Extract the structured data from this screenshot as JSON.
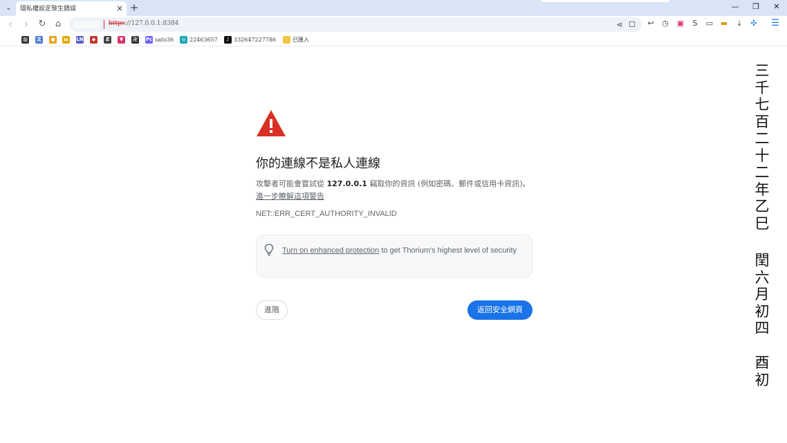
{
  "tab": {
    "title": "隱私權設定發生錯誤",
    "close_glyph": "×"
  },
  "tabstrip": {
    "new_tab_glyph": "+",
    "minimize_glyph": "—",
    "restore_glyph": "❐",
    "close_glyph": "✕"
  },
  "toolbar": {
    "back_glyph": "‹",
    "forward_glyph": "›",
    "reload_glyph": "↻",
    "home_glyph": "⌂",
    "url_scheme": "https",
    "url_rest": "://127.0.0.1:8384",
    "share_glyph": "⋖",
    "bookmark_glyph": "☐",
    "menu_glyph": "☰"
  },
  "extensions": [
    {
      "icon": "reply-arrow-icon",
      "glyph": "↩"
    },
    {
      "icon": "clock-icon",
      "glyph": "◷"
    },
    {
      "icon": "red-square-icon",
      "glyph": "▣"
    },
    {
      "icon": "s-letter-icon",
      "glyph": "S"
    },
    {
      "icon": "wallet-icon",
      "glyph": "▭"
    },
    {
      "icon": "folder-icon",
      "glyph": "▬"
    },
    {
      "icon": "download-icon",
      "glyph": "⤓"
    },
    {
      "icon": "puzzle-icon",
      "glyph": "✣"
    }
  ],
  "bookmarks": [
    {
      "label": "",
      "glyph": "▥",
      "color": "#333333"
    },
    {
      "label": "",
      "glyph": "文",
      "color": "#4a7bd0"
    },
    {
      "label": "",
      "glyph": "●",
      "color": "#e8a317"
    },
    {
      "label": "",
      "glyph": "ы",
      "color": "#e5a800"
    },
    {
      "label": "",
      "glyph": "LN",
      "color": "#5b5fc7"
    },
    {
      "label": "",
      "glyph": "◆",
      "color": "#c0392b"
    },
    {
      "label": "",
      "glyph": "Ƶ",
      "color": "#444444"
    },
    {
      "label": "",
      "glyph": "▼",
      "color": "#d6336c"
    },
    {
      "label": "",
      "glyph": "卍",
      "color": "#2f2f2f"
    },
    {
      "label": "sato36",
      "glyph": "Pc",
      "color": "#6c63ff"
    },
    {
      "label": "22463657",
      "glyph": "◎",
      "color": "#17a2b8"
    },
    {
      "label": "332647227786",
      "glyph": "♪",
      "color": "#111111"
    },
    {
      "label": "已匯入",
      "glyph": "▬",
      "color": "#f4c542"
    }
  ],
  "interstitial": {
    "heading": "你的連線不是私人連線",
    "body_before": "攻擊者可能會嘗試從",
    "body_host": "127.0.0.1",
    "body_after": "竊取你的資訊 (例如密碼、郵件或信用卡資訊)。",
    "learn_more": "進一步瞭解這項警告",
    "error_code": "NET::ERR_CERT_AUTHORITY_INVALID",
    "enhanced_link": "Turn on enhanced protection",
    "enhanced_rest": " to get Thorium's highest level of security",
    "advanced_label": "進階",
    "back_label": "返回安全網頁"
  },
  "overlay": {
    "columns": [
      "三千七百二十二年乙巳",
      "閏六月初四",
      "酉初"
    ]
  }
}
